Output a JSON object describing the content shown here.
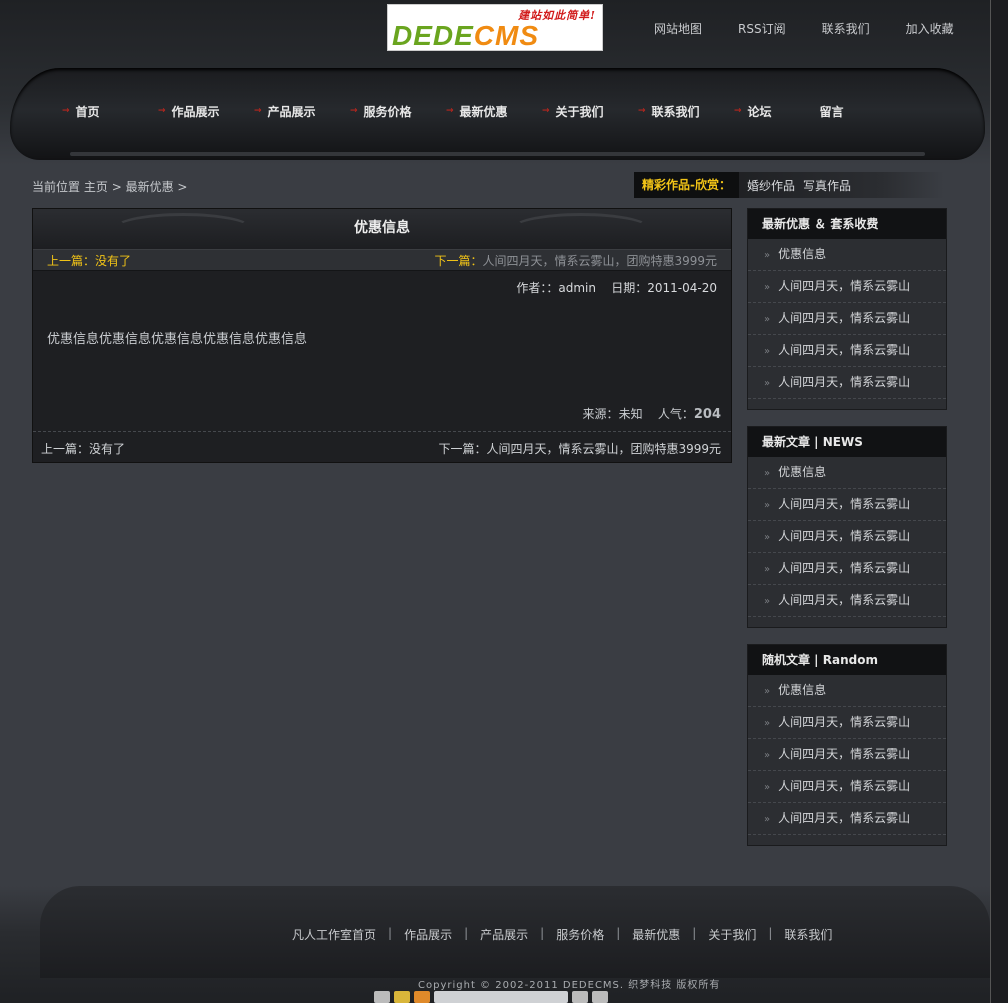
{
  "header": {
    "logo_slogan": "建站如此简单!",
    "logo_brand_1": "DEDE",
    "logo_brand_2": "CMS",
    "top_links": [
      "网站地图",
      "RSS订阅",
      "联系我们",
      "加入收藏"
    ],
    "nav": [
      "首页",
      "作品展示",
      "产品展示",
      "服务价格",
      "最新优惠",
      "关于我们",
      "联系我们",
      "论坛",
      "留言"
    ]
  },
  "breadcrumb": {
    "prefix": "当前位置",
    "home": "主页",
    "sep": ">",
    "current": "最新优惠"
  },
  "featured": {
    "label": "精彩作品-欣赏：",
    "links": [
      "婚纱作品",
      "写真作品"
    ]
  },
  "article": {
    "title": "优惠信息",
    "prev_top_label": "上一篇：",
    "prev_top_value": "没有了",
    "next_top_label": "下一篇：",
    "next_top_value": "人间四月天，情系云雾山，团购特惠3999元",
    "author_label": "作者：：",
    "author": "admin",
    "date_label": "日期：",
    "date": "2011-04-20",
    "body": "优惠信息优惠信息优惠信息优惠信息优惠信息",
    "source_label": "来源：",
    "source": "未知",
    "views_label": "人气：",
    "views": "204",
    "prev_bottom": "上一篇：没有了",
    "next_bottom": "下一篇：人间四月天，情系云雾山，团购特惠3999元"
  },
  "sidebar": [
    {
      "title": "最新优惠 ＆ 套系收费",
      "items": [
        "优惠信息",
        "人间四月天，情系云雾山",
        "人间四月天，情系云雾山",
        "人间四月天，情系云雾山",
        "人间四月天，情系云雾山"
      ]
    },
    {
      "title": "最新文章 | NEWS",
      "items": [
        "优惠信息",
        "人间四月天，情系云雾山",
        "人间四月天，情系云雾山",
        "人间四月天，情系云雾山",
        "人间四月天，情系云雾山"
      ]
    },
    {
      "title": "随机文章 | Random",
      "items": [
        "优惠信息",
        "人间四月天，情系云雾山",
        "人间四月天，情系云雾山",
        "人间四月天，情系云雾山",
        "人间四月天，情系云雾山"
      ]
    }
  ],
  "footer": {
    "links": [
      "凡人工作室首页",
      "作品展示",
      "产品展示",
      "服务价格",
      "最新优惠",
      "关于我们",
      "联系我们"
    ],
    "link_sep": "|",
    "copyright": "Copyright © 2002-2011 DEDECMS. 织梦科技 版权所有"
  },
  "colors": {
    "accent_yellow": "#f2c417",
    "background": "#3a3d43",
    "logo_green": "#6aa51f",
    "logo_orange": "#f08b12"
  }
}
